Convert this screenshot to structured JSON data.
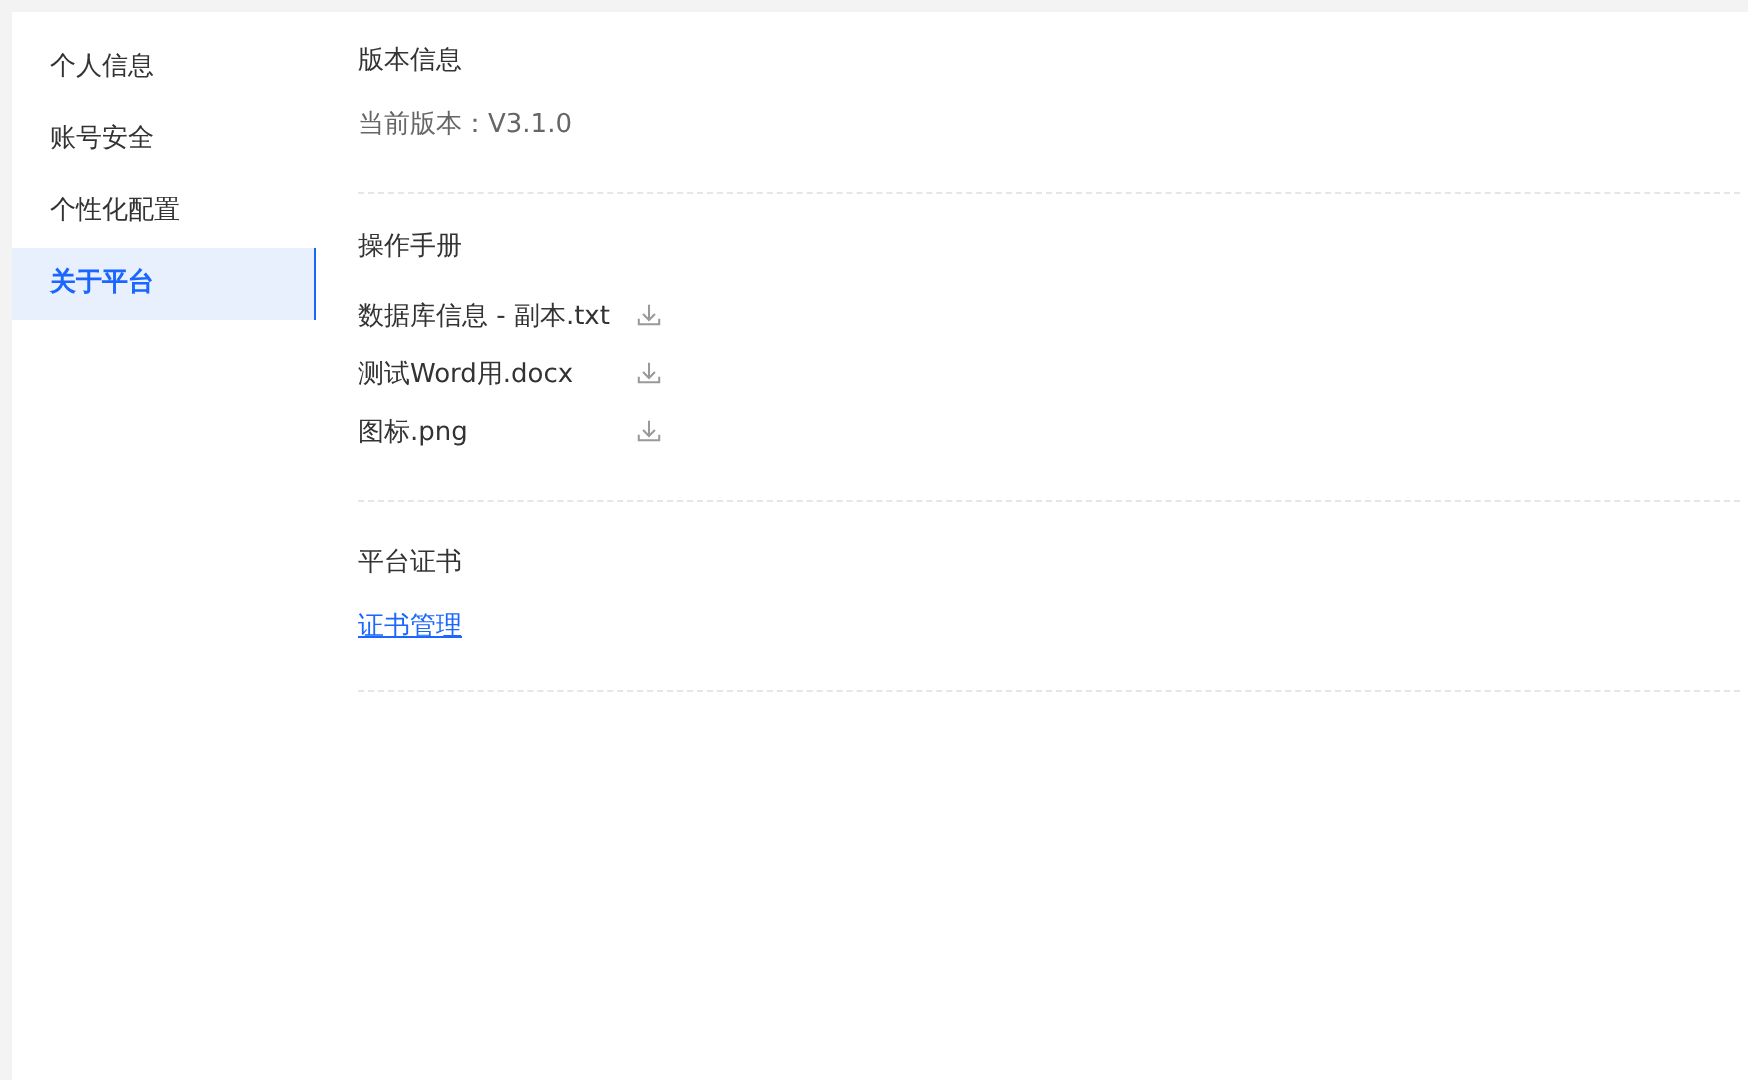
{
  "sidebar": {
    "items": [
      {
        "label": "个人信息",
        "selected": false
      },
      {
        "label": "账号安全",
        "selected": false
      },
      {
        "label": "个性化配置",
        "selected": false
      },
      {
        "label": "关于平台",
        "selected": true
      }
    ]
  },
  "version_section": {
    "title": "版本信息",
    "current_version": "当前版本：V3.1.0"
  },
  "manual_section": {
    "title": "操作手册",
    "files": [
      {
        "name": "数据库信息 - 副本.txt"
      },
      {
        "name": "测试Word用.docx"
      },
      {
        "name": "图标.png"
      }
    ]
  },
  "certificate_section": {
    "title": "平台证书",
    "link": "证书管理"
  }
}
